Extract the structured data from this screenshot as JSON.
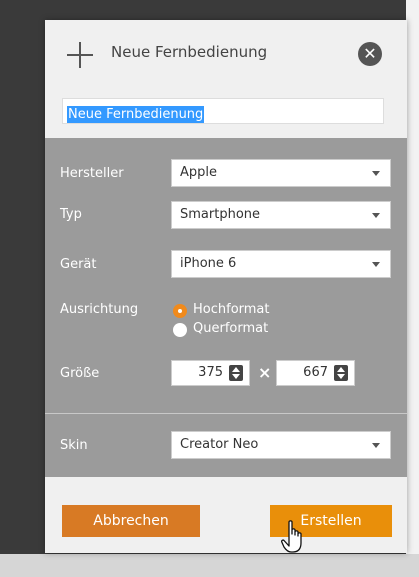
{
  "dialog": {
    "title": "Neue Fernbedienung",
    "name_value": "Neue Fernbedienung"
  },
  "form": {
    "manufacturer": {
      "label": "Hersteller",
      "value": "Apple"
    },
    "type": {
      "label": "Typ",
      "value": "Smartphone"
    },
    "device": {
      "label": "Gerät",
      "value": "iPhone 6"
    },
    "orientation": {
      "label": "Ausrichtung",
      "options": [
        "Hochformat",
        "Querformat"
      ],
      "selected": "Hochformat"
    },
    "size": {
      "label": "Größe",
      "width": "375",
      "height": "667",
      "separator": "×"
    },
    "skin": {
      "label": "Skin",
      "value": "Creator Neo"
    }
  },
  "buttons": {
    "cancel": "Abbrechen",
    "create": "Erstellen"
  },
  "colors": {
    "accent": "#e98f0a",
    "cancel": "#d87a24",
    "panel": "#9b9b9b",
    "header": "#f0f0f0",
    "selection": "#3399ff"
  }
}
